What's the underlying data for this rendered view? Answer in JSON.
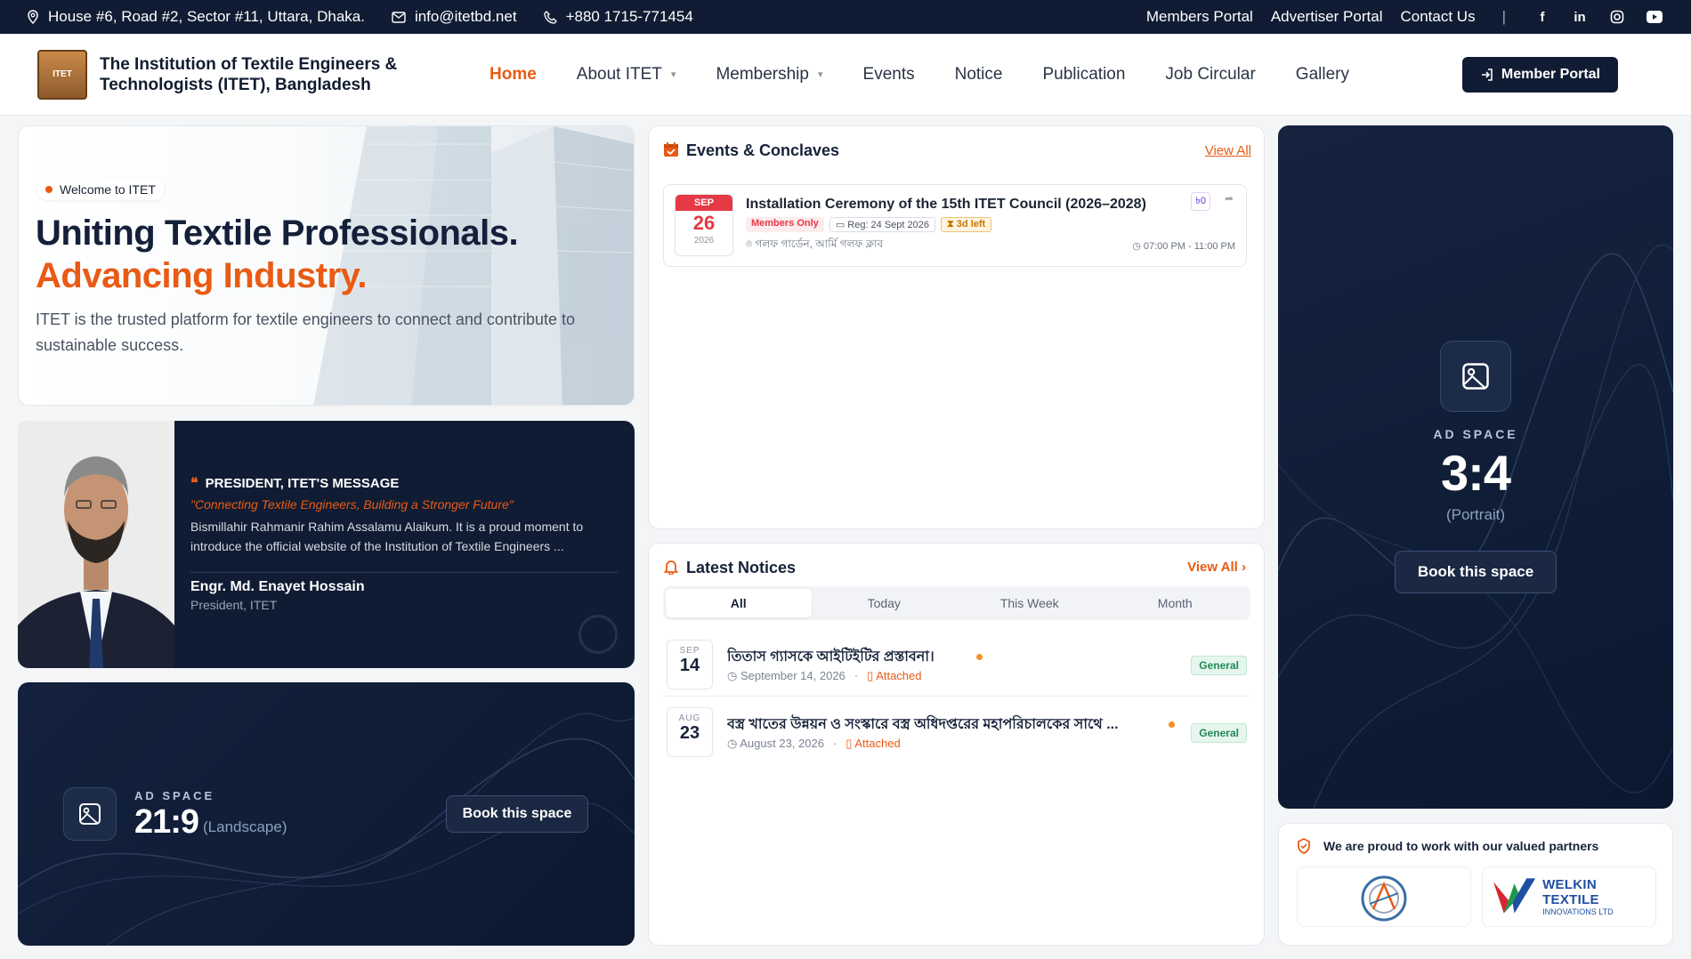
{
  "topbar": {
    "address": "House #6, Road #2, Sector #11, Uttara, Dhaka.",
    "email": "info@itetbd.net",
    "phone": "+880 1715-771454",
    "links": [
      "Members Portal",
      "Advertiser Portal",
      "Contact Us"
    ],
    "social": [
      "facebook-icon",
      "linkedin-icon",
      "instagram-icon",
      "youtube-icon"
    ]
  },
  "navbar": {
    "brand_line1": "The Institution of Textile Engineers &",
    "brand_line2": "Technologists (ITET), Bangladesh",
    "items": [
      {
        "label": "Home",
        "active": true
      },
      {
        "label": "About ITET",
        "dropdown": true
      },
      {
        "label": "Membership",
        "dropdown": true
      },
      {
        "label": "Events"
      },
      {
        "label": "Notice"
      },
      {
        "label": "Publication"
      },
      {
        "label": "Job Circular"
      },
      {
        "label": "Gallery"
      }
    ],
    "member_button": "Member Portal"
  },
  "hero": {
    "pill": "Welcome to ITET",
    "title_line1": "Uniting Textile Professionals.",
    "title_line2": "Advancing Industry.",
    "description": "ITET is the trusted platform for textile engineers to connect and contribute to sustainable success."
  },
  "president": {
    "heading": "PRESIDENT, ITET'S MESSAGE",
    "quote": "\"Connecting Textile Engineers, Building a Stronger Future\"",
    "message": "Bismillahir Rahmanir Rahim Assalamu Alaikum. It is a proud moment to introduce the official website of the Institution of Textile Engineers ...",
    "name": "Engr. Md. Enayet Hossain",
    "role": "President, ITET"
  },
  "ad_landscape": {
    "label": "AD SPACE",
    "ratio": "21:9",
    "orientation": "(Landscape)",
    "button": "Book this space"
  },
  "events": {
    "title": "Events & Conclaves",
    "view_all": "View All",
    "items": [
      {
        "month": "SEP",
        "day": "26",
        "year": "2026",
        "title": "Installation Ceremony of the 15th ITET Council (2026–2028)",
        "tag_access": "Members Only",
        "tag_reg": "Reg: 24 Sept 2026",
        "tag_left": "3d left",
        "price": "৳0",
        "location": "গলফ গার্ডেন, আর্মি গলফ ক্লাব",
        "time": "07:00 PM - 11:00 PM"
      }
    ]
  },
  "notices": {
    "title": "Latest Notices",
    "view_all": "View All",
    "tabs": [
      "All",
      "Today",
      "This Week",
      "Month"
    ],
    "active_tab": "All",
    "items": [
      {
        "month": "SEP",
        "day": "14",
        "title": "তিতাস গ্যাসকে আইটিইটির প্রস্তাবনা।",
        "date": "September 14, 2026",
        "attachment": "Attached",
        "category": "General"
      },
      {
        "month": "AUG",
        "day": "23",
        "title": "বস্ত্র খাতের উন্নয়ন ও সংস্কারে বস্ত্র অধিদপ্তরের মহাপরিচালকের সাথে ...",
        "date": "August 23, 2026",
        "attachment": "Attached",
        "category": "General"
      }
    ]
  },
  "ad_portrait": {
    "label": "AD SPACE",
    "ratio": "3:4",
    "orientation": "(Portrait)",
    "button": "Book this space"
  },
  "partners": {
    "title": "We are proud to work with our valued partners",
    "logo2_name": "WELKIN TEXTILE",
    "logo2_sub": "INNOVATIONS LTD"
  },
  "colors": {
    "accent": "#ea5a14",
    "navy": "#0f1c33",
    "event_red": "#e53946",
    "success": "#1f8a57"
  }
}
